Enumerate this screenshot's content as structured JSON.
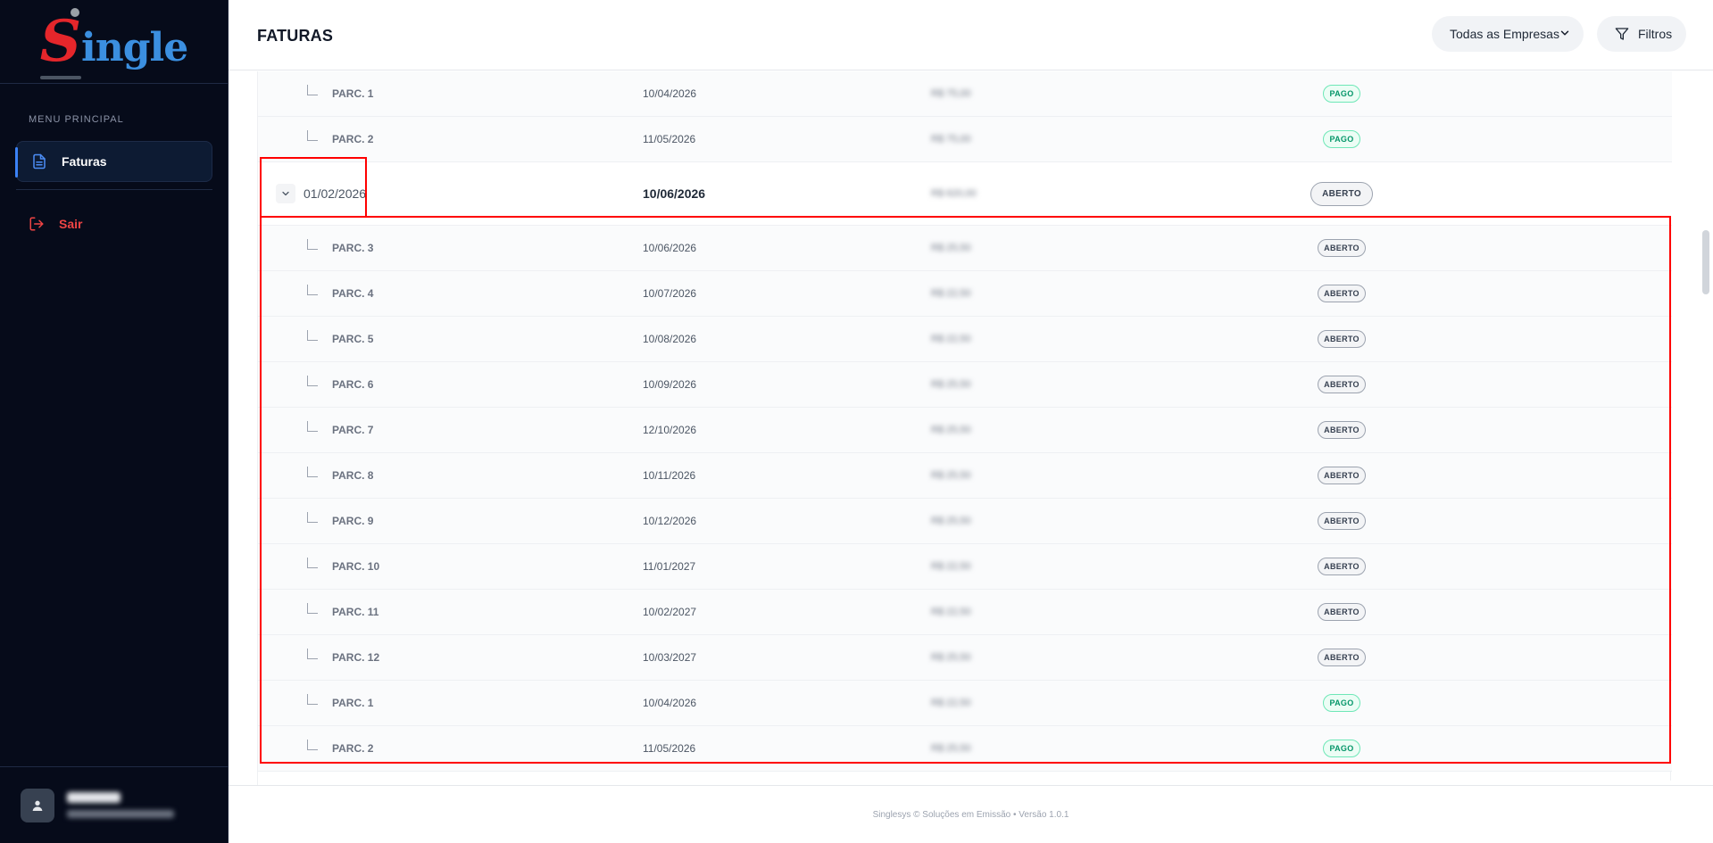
{
  "app": {
    "logo_letter": "S",
    "logo_rest": "ingle"
  },
  "sidebar": {
    "section_label": "MENU PRINCIPAL",
    "items": [
      {
        "label": "Faturas",
        "icon": "document-icon",
        "active": true
      },
      {
        "label": "Sair",
        "icon": "logout-icon",
        "active": false
      }
    ]
  },
  "header": {
    "title": "FATURAS",
    "company_select": "Todas as Empresas",
    "filter_label": "Filtros"
  },
  "table": {
    "top_rows": [
      {
        "label": "PARC. 1",
        "due": "10/04/2026",
        "amount": "R$ 75,00",
        "status": "PAGO"
      },
      {
        "label": "PARC. 2",
        "due": "11/05/2026",
        "amount": "R$ 75,00",
        "status": "PAGO"
      }
    ],
    "parent": {
      "reference": "01/02/2026",
      "due": "10/06/2026",
      "amount": "R$ 620,00",
      "status": "ABERTO"
    },
    "child_rows": [
      {
        "label": "PARC. 3",
        "due": "10/06/2026",
        "amount": "R$ 25,50",
        "status": "ABERTO"
      },
      {
        "label": "PARC. 4",
        "due": "10/07/2026",
        "amount": "R$ 22,50",
        "status": "ABERTO"
      },
      {
        "label": "PARC. 5",
        "due": "10/08/2026",
        "amount": "R$ 22,50",
        "status": "ABERTO"
      },
      {
        "label": "PARC. 6",
        "due": "10/09/2026",
        "amount": "R$ 25,50",
        "status": "ABERTO"
      },
      {
        "label": "PARC. 7",
        "due": "12/10/2026",
        "amount": "R$ 25,50",
        "status": "ABERTO"
      },
      {
        "label": "PARC. 8",
        "due": "10/11/2026",
        "amount": "R$ 25,50",
        "status": "ABERTO"
      },
      {
        "label": "PARC. 9",
        "due": "10/12/2026",
        "amount": "R$ 25,50",
        "status": "ABERTO"
      },
      {
        "label": "PARC. 10",
        "due": "11/01/2027",
        "amount": "R$ 22,50",
        "status": "ABERTO"
      },
      {
        "label": "PARC. 11",
        "due": "10/02/2027",
        "amount": "R$ 22,50",
        "status": "ABERTO"
      },
      {
        "label": "PARC. 12",
        "due": "10/03/2027",
        "amount": "R$ 25,50",
        "status": "ABERTO"
      },
      {
        "label": "PARC. 1",
        "due": "10/04/2026",
        "amount": "R$ 22,50",
        "status": "PAGO"
      },
      {
        "label": "PARC. 2",
        "due": "11/05/2026",
        "amount": "R$ 25,50",
        "status": "PAGO"
      }
    ]
  },
  "footer": {
    "text": "Singlesys © Soluções em Emissão • Versão 1.0.1"
  },
  "colors": {
    "sidebar_bg": "#060b1a",
    "accent": "#3b82f6",
    "danger": "#ef4444",
    "paid_green": "#059669",
    "highlight": "#ff0000"
  }
}
